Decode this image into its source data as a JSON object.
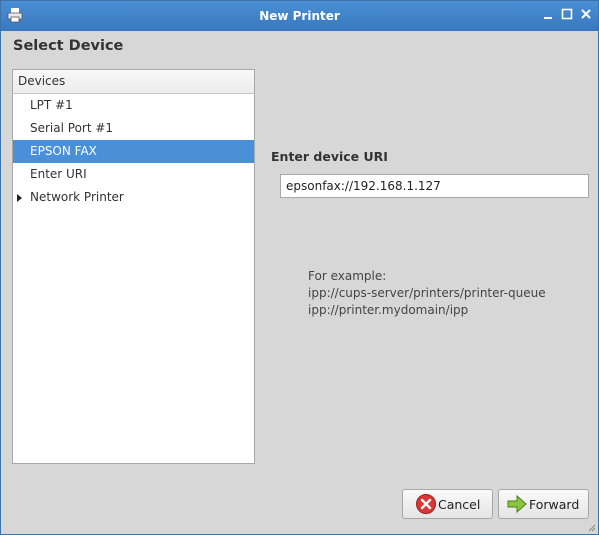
{
  "window": {
    "title": "New Printer"
  },
  "heading": "Select Device",
  "devices": {
    "header": "Devices",
    "items": [
      {
        "label": "LPT #1"
      },
      {
        "label": "Serial Port #1"
      },
      {
        "label": "EPSON FAX"
      },
      {
        "label": "Enter URI"
      },
      {
        "label": "Network Printer"
      }
    ]
  },
  "uri": {
    "label": "Enter device URI",
    "value": "epsonfax://192.168.1.127"
  },
  "example": {
    "line1": "For example:",
    "line2": "ipp://cups-server/printers/printer-queue",
    "line3": "ipp://printer.mydomain/ipp"
  },
  "buttons": {
    "cancel": "Cancel",
    "forward": "Forward"
  },
  "colors": {
    "titlebar": "#3d84c9",
    "selection": "#4a90d9",
    "background": "#d7d7d7"
  },
  "icons": [
    "printer-icon",
    "minimize-icon",
    "maximize-icon",
    "close-icon",
    "cancel-icon",
    "forward-arrow-icon",
    "expander-arrow-icon",
    "resize-grip-icon"
  ]
}
